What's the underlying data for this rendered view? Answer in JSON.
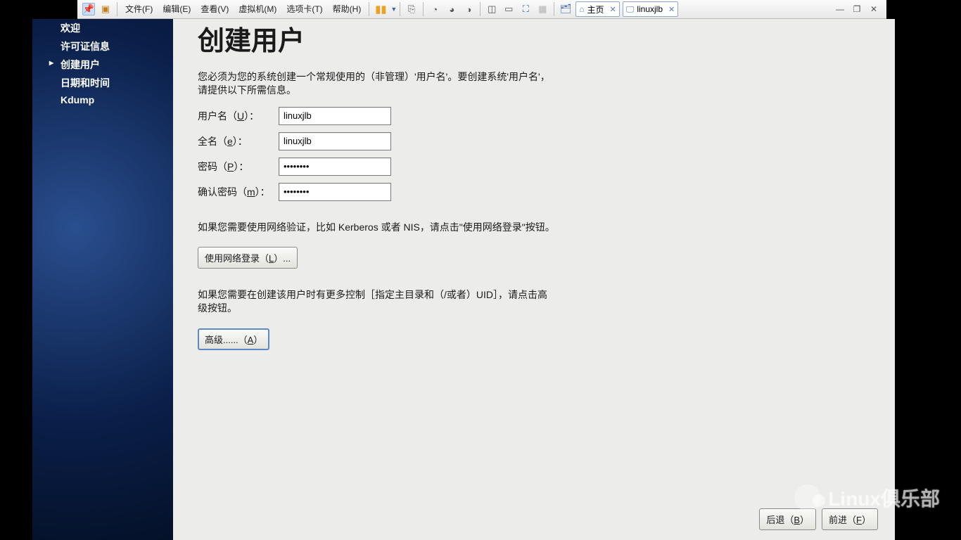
{
  "menus": {
    "file": "文件(F)",
    "edit": "编辑(E)",
    "view": "查看(V)",
    "vm": "虚拟机(M)",
    "tabs": "选项卡(T)",
    "help": "帮助(H)"
  },
  "tabs": {
    "home": "主页",
    "vm": "linuxjlb"
  },
  "sidebar": {
    "items": [
      {
        "label": "欢迎"
      },
      {
        "label": "许可证信息"
      },
      {
        "label": "创建用户",
        "active": true
      },
      {
        "label": "日期和时间"
      },
      {
        "label": "Kdump"
      }
    ]
  },
  "page": {
    "title": "创建用户",
    "desc": "您必须为您的系统创建一个常规使用的（非管理）'用户名'。要创建系统'用户名'，请提供以下所需信息。",
    "username_label_pre": "用户名（",
    "username_label_u": "U",
    "username_label_post": "）：",
    "username_value": "linuxjlb",
    "fullname_label_pre": "全名（",
    "fullname_label_u": "e",
    "fullname_label_post": "）：",
    "fullname_value": "linuxjlb",
    "password_label_pre": "密码（",
    "password_label_u": "P",
    "password_label_post": "）：",
    "password_value": "••••••••",
    "confirm_label_pre": "确认密码（",
    "confirm_label_u": "m",
    "confirm_label_post": "）：",
    "confirm_value": "••••••••",
    "net_login_desc": "如果您需要使用网络验证，比如 Kerberos 或者 NIS，请点击\"使用网络登录\"按钮。",
    "net_login_btn_pre": "使用网络登录（",
    "net_login_btn_u": "L",
    "net_login_btn_post": "）...",
    "advanced_desc": "如果您需要在创建该用户时有更多控制［指定主目录和（/或者）UID］，请点击高级按钮。",
    "advanced_btn_pre": "高级......（",
    "advanced_btn_u": "A",
    "advanced_btn_post": "）",
    "back_btn_pre": "后退（",
    "back_btn_u": "B",
    "back_btn_post": "）",
    "forward_btn_pre": "前进（",
    "forward_btn_u": "F",
    "forward_btn_post": "）"
  },
  "watermark": "Linux俱乐部"
}
